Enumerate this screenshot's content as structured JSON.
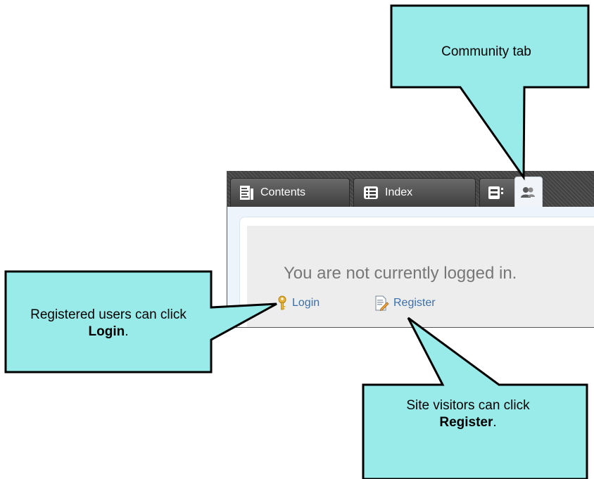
{
  "tabs": [
    {
      "label": "Contents",
      "icon": "contents-icon"
    },
    {
      "label": "Index",
      "icon": "index-icon"
    },
    {
      "label": "",
      "icon": "browse-sequences-icon"
    },
    {
      "label": "",
      "icon": "community-icon",
      "active": true
    }
  ],
  "community": {
    "status_message": "You are not currently logged in.",
    "login_label": "Login",
    "register_label": "Register"
  },
  "callouts": {
    "community_tab": "Community tab",
    "login_prefix": "Registered users can click",
    "login_bold": "Login",
    "login_suffix": ".",
    "register_prefix": "Site visitors can click",
    "register_bold": "Register",
    "register_suffix": "."
  },
  "colors": {
    "callout_fill": "#99ebea",
    "callout_border": "#000000",
    "link": "#3c6fa8",
    "status_text": "#777777",
    "tab_active_bg": "#f1f5fa"
  }
}
